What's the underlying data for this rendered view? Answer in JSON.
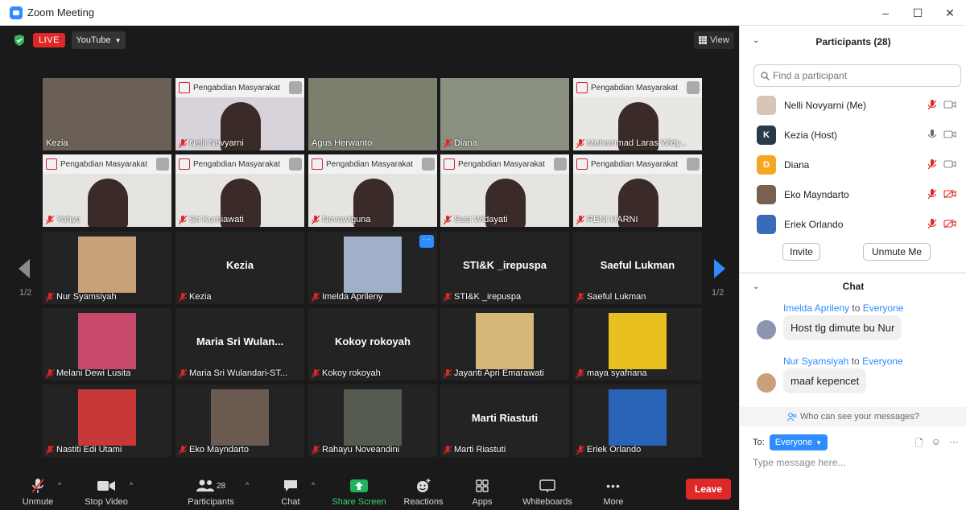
{
  "window": {
    "title": "Zoom Meeting",
    "min": "–",
    "max": "☐",
    "close": "✕"
  },
  "topbar": {
    "live": "LIVE",
    "youtube": "YouTube",
    "view": "View"
  },
  "tiles": [
    {
      "name": "Kezia",
      "muted": false,
      "active": true,
      "bg": "#6a6055",
      "center": ""
    },
    {
      "name": "Nelli  Novyarni",
      "muted": true,
      "bg": "#d8d2da",
      "banner": "Pengabdian Masyarakat",
      "center": ""
    },
    {
      "name": "Agus Herwanto",
      "muted": false,
      "bg": "#7a7f6e",
      "center": ""
    },
    {
      "name": "Diana",
      "muted": true,
      "bg": "#8a9080",
      "center": ""
    },
    {
      "name": "Muhammad Laras Widy...",
      "muted": true,
      "bg": "#e9e7e4",
      "banner": "Pengabdian Masyarakat",
      "center": ""
    },
    {
      "name": "Yahya",
      "muted": true,
      "bg": "#e6e4e1",
      "banner": "Pengabdian Masyarakat",
      "center": ""
    },
    {
      "name": "Sri Kurniawati",
      "muted": true,
      "bg": "#e6e4e1",
      "banner": "Pengabdian Masyarakat",
      "center": ""
    },
    {
      "name": "Novawiguna",
      "muted": true,
      "bg": "#e6e4e1",
      "banner": "Pengabdian Masyarakat",
      "center": ""
    },
    {
      "name": "Susi Widayati",
      "muted": true,
      "bg": "#e6e4e1",
      "banner": "Pengabdian Masyarakat",
      "center": ""
    },
    {
      "name": "RENI  HARNI",
      "muted": true,
      "bg": "#e6e4e1",
      "banner": "Pengabdian Masyarakat",
      "center": ""
    },
    {
      "name": "Nur Syamsiyah",
      "muted": true,
      "bg": "#232323",
      "photo": "#c8a07a",
      "center": ""
    },
    {
      "name": "Kezia",
      "muted": true,
      "bg": "#232323",
      "center": "Kezia"
    },
    {
      "name": "Imelda Aprileny",
      "muted": true,
      "bg": "#232323",
      "photo": "#9fb0c8",
      "center": "",
      "more": "···"
    },
    {
      "name": "STI&K _irepuspa",
      "muted": true,
      "bg": "#232323",
      "center": "STI&K _irepuspa"
    },
    {
      "name": "Saeful Lukman",
      "muted": true,
      "bg": "#232323",
      "center": "Saeful Lukman"
    },
    {
      "name": "Melani Dewi Lusita",
      "muted": true,
      "bg": "#232323",
      "photo": "#c84a6a",
      "center": ""
    },
    {
      "name": "Maria Sri Wulandari-ST...",
      "muted": true,
      "bg": "#232323",
      "center": "Maria  Sri  Wulan..."
    },
    {
      "name": "Kokoy rokoyah",
      "muted": true,
      "bg": "#232323",
      "center": "Kokoy rokoyah"
    },
    {
      "name": "Jayanti Apri Emarawati",
      "muted": true,
      "bg": "#232323",
      "photo": "#d8b87a",
      "center": ""
    },
    {
      "name": "maya syafriana",
      "muted": true,
      "bg": "#232323",
      "photo": "#e8c020",
      "center": ""
    },
    {
      "name": "Nastiti Edi Utami",
      "muted": true,
      "bg": "#232323",
      "photo": "#c83838",
      "center": ""
    },
    {
      "name": "Eko Mayndarto",
      "muted": true,
      "bg": "#232323",
      "photo": "#6a5a50",
      "center": ""
    },
    {
      "name": "Rahayu Noveandini",
      "muted": true,
      "bg": "#232323",
      "photo": "#555a50",
      "center": ""
    },
    {
      "name": "Marti Riastuti",
      "muted": true,
      "bg": "#232323",
      "center": "Marti Riastuti"
    },
    {
      "name": "Eriek Orlando",
      "muted": true,
      "bg": "#232323",
      "photo": "#2a64b8",
      "center": ""
    }
  ],
  "pager": {
    "left": "1/2",
    "right": "1/2"
  },
  "toolbar": {
    "unmute": "Unmute",
    "stop_video": "Stop Video",
    "participants": "Participants",
    "participants_count": "28",
    "chat": "Chat",
    "share": "Share Screen",
    "reactions": "Reactions",
    "apps": "Apps",
    "whiteboards": "Whiteboards",
    "more": "More",
    "leave": "Leave"
  },
  "panel": {
    "title": "Participants (28)",
    "search_placeholder": "Find a participant",
    "participants": [
      {
        "name": "Nelli  Novyarni (Me)",
        "avatar": "",
        "color": "#d9c5b8",
        "mic": "muted",
        "video": "off-gray"
      },
      {
        "name": "Kezia (Host)",
        "avatar": "K",
        "color": "#2b3a4a",
        "mic": "on",
        "video": "off-gray"
      },
      {
        "name": "Diana",
        "avatar": "D",
        "color": "#f5a623",
        "mic": "muted",
        "video": "off-gray"
      },
      {
        "name": "Eko Mayndarto",
        "avatar": "",
        "color": "#7a6050",
        "mic": "muted",
        "video": "off-red"
      },
      {
        "name": "Eriek Orlando",
        "avatar": "",
        "color": "#3a6ab8",
        "mic": "muted",
        "video": "off-red"
      }
    ],
    "invite": "Invite",
    "unmute_me": "Unmute Me",
    "chat_title": "Chat",
    "messages": [
      {
        "from": "Imelda Aprileny",
        "to": "to",
        "target": "Everyone",
        "text": "Host tlg dimute bu Nur",
        "avcolor": "#8a96b0"
      },
      {
        "from": "Nur Syamsiyah",
        "to": "to",
        "target": "Everyone",
        "text": "maaf kepencet",
        "avcolor": "#c8a07a"
      }
    ],
    "who_can_see": "Who can see your messages?",
    "to_label": "To:",
    "to_target": "Everyone",
    "type_placeholder": "Type message here..."
  }
}
